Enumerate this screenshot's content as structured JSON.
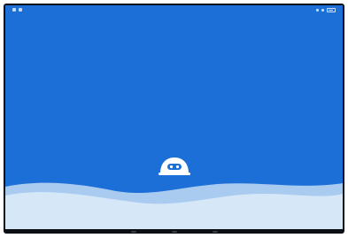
{
  "splash": {
    "app_logo_icon": "robot-face-icon",
    "loading_text": ""
  },
  "colors": {
    "background": "#1d6fd8",
    "wave_light": "#d6e7f8",
    "wave_mid": "#a9cbf0",
    "logo": "#ffffff",
    "text_accent": "#dbf07a"
  },
  "statusbar": {
    "left_icons": [
      "notification-icon",
      "notification-icon"
    ],
    "right_icons": [
      "signal-icon",
      "wifi-icon",
      "battery-icon"
    ]
  },
  "navbar": {
    "buttons": [
      "back-button",
      "home-button",
      "recents-button"
    ]
  }
}
